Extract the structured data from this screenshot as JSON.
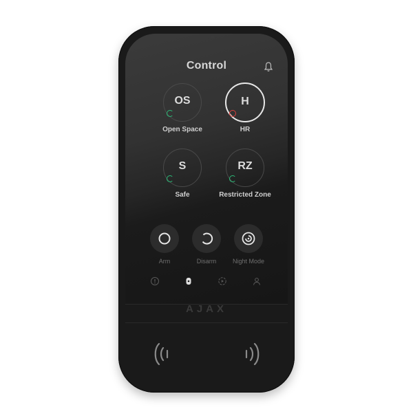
{
  "screen": {
    "title": "Control"
  },
  "zones": [
    {
      "abbr": "OS",
      "name": "Open Space",
      "status": "green",
      "active": false
    },
    {
      "abbr": "H",
      "name": "HR",
      "status": "red",
      "active": true
    },
    {
      "abbr": "S",
      "name": "Safe",
      "status": "green",
      "active": false
    },
    {
      "abbr": "RZ",
      "name": "Restricted Zone",
      "status": "green",
      "active": false
    }
  ],
  "actions": [
    {
      "label": "Arm",
      "icon": "arm-icon"
    },
    {
      "label": "Disarm",
      "icon": "disarm-icon"
    },
    {
      "label": "Night Mode",
      "icon": "night-mode-icon"
    }
  ],
  "nav": [
    "alert-icon",
    "keypad-icon",
    "automation-icon",
    "user-icon"
  ],
  "brand": "AJAX",
  "colors": {
    "status_green": "#2bbf7a",
    "status_red": "#e0413c"
  }
}
